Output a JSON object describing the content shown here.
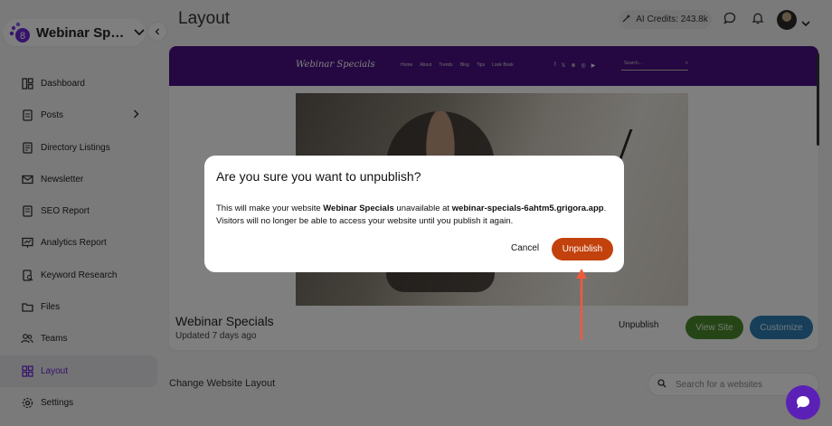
{
  "sidebar": {
    "site_name": "Webinar Specials",
    "logo_badge": "8",
    "items": [
      {
        "label": "Dashboard",
        "icon": "dashboard-icon"
      },
      {
        "label": "Posts",
        "icon": "posts-icon"
      },
      {
        "label": "Directory Listings",
        "icon": "directory-icon"
      },
      {
        "label": "Newsletter",
        "icon": "mail-icon"
      },
      {
        "label": "SEO Report",
        "icon": "seo-report-icon"
      },
      {
        "label": "Analytics Report",
        "icon": "analytics-icon"
      },
      {
        "label": "Keyword Research",
        "icon": "keyword-icon"
      },
      {
        "label": "Files",
        "icon": "folder-icon"
      },
      {
        "label": "Teams",
        "icon": "teams-icon"
      },
      {
        "label": "Layout",
        "icon": "layout-icon"
      },
      {
        "label": "Settings",
        "icon": "gear-icon"
      }
    ],
    "active_item": "Layout"
  },
  "header": {
    "title": "Layout",
    "credits": "AI Credits: 243.8k"
  },
  "preview": {
    "logo": "Webinar Specials",
    "links": [
      "Home",
      "About",
      "Trends",
      "Blog",
      "Tips",
      "Look Book"
    ],
    "social": [
      "f",
      "𝕏",
      "⊗",
      "◎",
      "▶"
    ],
    "search_placeholder": "Search..."
  },
  "site_card": {
    "name": "Webinar Specials",
    "updated": "Updated 7 days ago",
    "unpublish_label": "Unpublish",
    "view_label": "View Site",
    "customize_label": "Customize"
  },
  "layout_section": {
    "title": "Change Website Layout",
    "search_placeholder": "Search for a websites"
  },
  "modal": {
    "title": "Are you sure you want to unpublish?",
    "body_1": "This will make your website ",
    "site": "Webinar Specials",
    "body_2": " unavailable at ",
    "domain": "webinar-specials-6ahtm5.grigora.app",
    "body_3": ".",
    "body_4": "Visitors will no longer be able to access your website until you publish it again.",
    "cancel_label": "Cancel",
    "confirm_label": "Unpublish"
  },
  "colors": {
    "brand_purple": "#5b21b6",
    "preview_nav": "#4a1183",
    "view_site_green": "#4d8a2e",
    "customize_blue": "#2f7fb5",
    "unpublish_orange": "#c2410c",
    "annotation_arrow": "#f05a3a"
  }
}
